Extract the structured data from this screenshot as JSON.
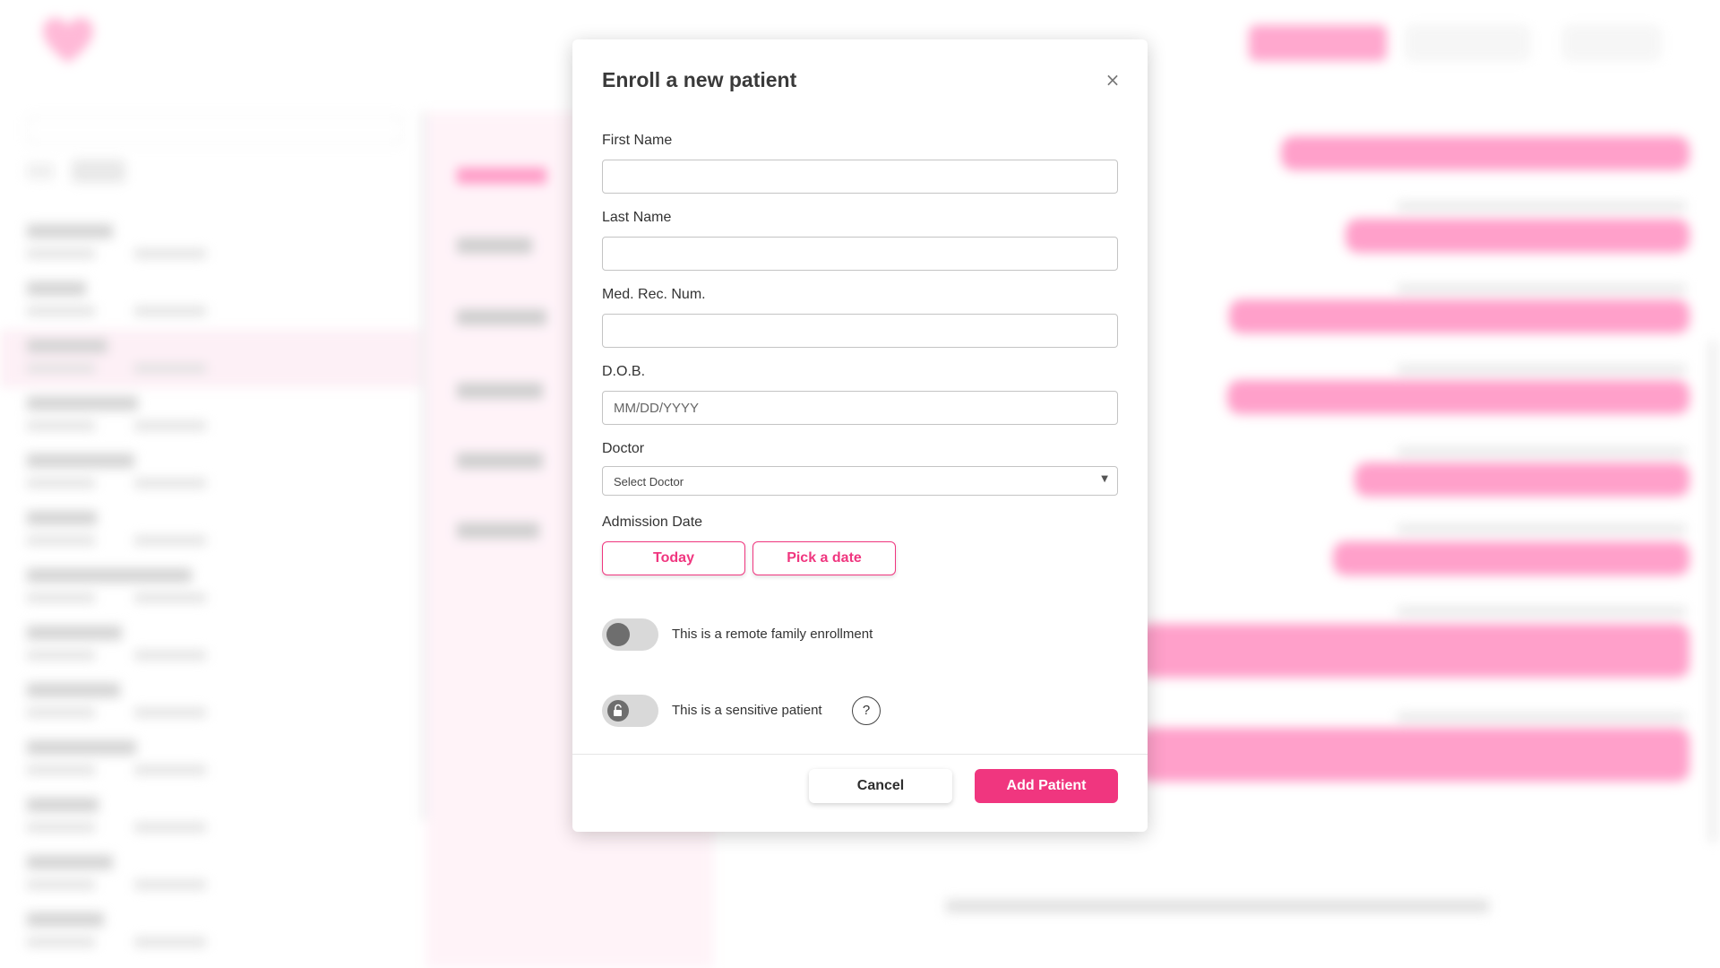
{
  "modal": {
    "title": "Enroll a new patient",
    "close_label": "×",
    "fields": {
      "first_name": {
        "label": "First Name",
        "value": "",
        "placeholder": ""
      },
      "last_name": {
        "label": "Last Name",
        "value": "",
        "placeholder": ""
      },
      "med_rec_num": {
        "label": "Med. Rec. Num.",
        "value": "",
        "placeholder": ""
      },
      "dob": {
        "label": "D.O.B.",
        "value": "",
        "placeholder": "MM/DD/YYYY"
      },
      "doctor": {
        "label": "Doctor",
        "selected": "Select Doctor"
      }
    },
    "admission": {
      "label": "Admission Date",
      "today_label": "Today",
      "pick_label": "Pick a date"
    },
    "toggles": {
      "remote": {
        "label": "This is a remote family enrollment",
        "on": false
      },
      "sensitive": {
        "label": "This is a sensitive patient",
        "on": false,
        "help_label": "?"
      }
    },
    "actions": {
      "cancel_label": "Cancel",
      "add_label": "Add Patient"
    }
  },
  "colors": {
    "accent": "#f0367f",
    "background_pink": "#ff93c3"
  },
  "icons": {
    "close": "close-icon",
    "dropdown": "chevron-down-icon",
    "lock": "unlock-icon",
    "help": "help-icon"
  }
}
